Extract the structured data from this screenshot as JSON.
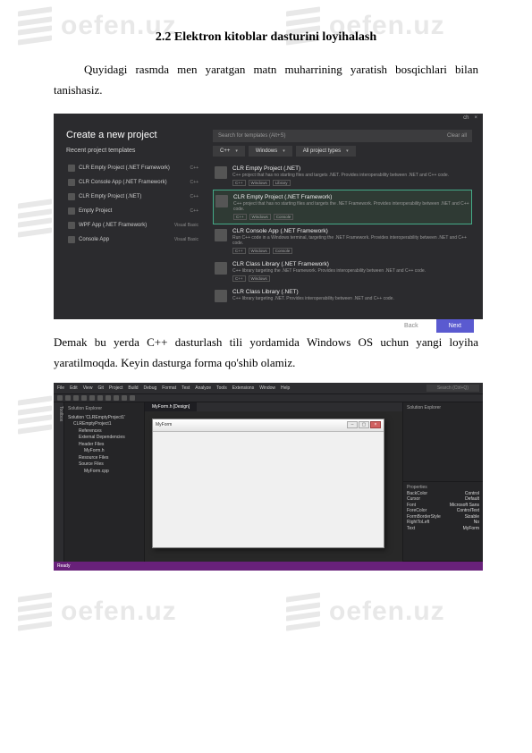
{
  "watermark": "oefen.uz",
  "title": "2.2 Elektron kitoblar  dasturini loyihalash",
  "para1": "Quyidagi rasmda men yaratgan matn muharrining yaratish bosqichlari bilan tanishasiz.",
  "para2": "Demak bu yerda C++ dasturlash tili yordamida Windows OS uchun yangi loyiha yaratilmoqda. Keyin dasturga forma qo'shib olamiz.",
  "vs1": {
    "winbar_left": "ch",
    "winbar_x": "×",
    "clear": "Clear all",
    "heading": "Create a new project",
    "recent_label": "Recent project templates",
    "recent": [
      {
        "name": "CLR Empty Project (.NET Framework)",
        "lang": "C++"
      },
      {
        "name": "CLR Console App (.NET Framework)",
        "lang": "C++"
      },
      {
        "name": "CLR Empty Project (.NET)",
        "lang": "C++"
      },
      {
        "name": "Empty Project",
        "lang": "C++"
      },
      {
        "name": "WPF App (.NET Framework)",
        "lang": "Visual Basic"
      },
      {
        "name": "Console App",
        "lang": "Visual Basic"
      }
    ],
    "search_placeholder": "Search for templates (Alt+S)",
    "filter1": "C++",
    "filter2": "Windows",
    "filter3": "All project types",
    "templates": [
      {
        "name": "CLR Empty Project (.NET)",
        "desc": "C++ project that has no starting files and targets .NET. Provides interoperability between .NET and C++ code.",
        "tags": [
          "C++",
          "Windows",
          "Library"
        ]
      },
      {
        "name": "CLR Empty Project (.NET Framework)",
        "desc": "C++ project that has no starting files and targets the .NET Framework. Provides interoperability between .NET and C++ code.",
        "tags": [
          "C++",
          "Windows",
          "Console"
        ],
        "selected": true
      },
      {
        "name": "CLR Console App (.NET Framework)",
        "desc": "Run C++ code in a Windows terminal, targeting the .NET Framework. Provides interoperability between .NET and C++ code.",
        "tags": [
          "C++",
          "Windows",
          "Console"
        ]
      },
      {
        "name": "CLR Class Library (.NET Framework)",
        "desc": "C++ library targeting the .NET Framework. Provides interoperability between .NET and C++ code.",
        "tags": [
          "C++",
          "Windows"
        ]
      },
      {
        "name": "CLR Class Library (.NET)",
        "desc": "C++ library targeting .NET. Provides interoperability between .NET and C++ code.",
        "tags": []
      }
    ],
    "back": "Back",
    "next": "Next"
  },
  "vs2": {
    "menus": [
      "File",
      "Edit",
      "View",
      "Git",
      "Project",
      "Build",
      "Debug",
      "Format",
      "Test",
      "Analyze",
      "Tools",
      "Extensions",
      "Window",
      "Help"
    ],
    "search": "Search (Ctrl+Q)",
    "toolbox_tab": "Toolbox",
    "explorer_hdr": "Solution Explorer",
    "tree": [
      {
        "t": "Solution 'CLREmptyProject1'",
        "cls": ""
      },
      {
        "t": "CLREmptyProject1",
        "cls": "in1"
      },
      {
        "t": "References",
        "cls": "in2"
      },
      {
        "t": "External Dependencies",
        "cls": "in2"
      },
      {
        "t": "Header Files",
        "cls": "in2"
      },
      {
        "t": "MyForm.h",
        "cls": "in3"
      },
      {
        "t": "Resource Files",
        "cls": "in2"
      },
      {
        "t": "Source Files",
        "cls": "in2"
      },
      {
        "t": "MyForm.cpp",
        "cls": "in3"
      }
    ],
    "tab_active": "MyForm.h [Design]",
    "form_title": "MyForm",
    "right_panels": {
      "p1": "Solution Explorer",
      "p2": "Properties",
      "props": [
        {
          "k": "BackColor",
          "v": "Control"
        },
        {
          "k": "Cursor",
          "v": "Default"
        },
        {
          "k": "Font",
          "v": "Microsoft Sans"
        },
        {
          "k": "ForeColor",
          "v": "ControlText"
        },
        {
          "k": "FormBorderStyle",
          "v": "Sizable"
        },
        {
          "k": "RightToLeft",
          "v": "No"
        },
        {
          "k": "Text",
          "v": "MyForm"
        }
      ]
    },
    "status": "Ready"
  }
}
